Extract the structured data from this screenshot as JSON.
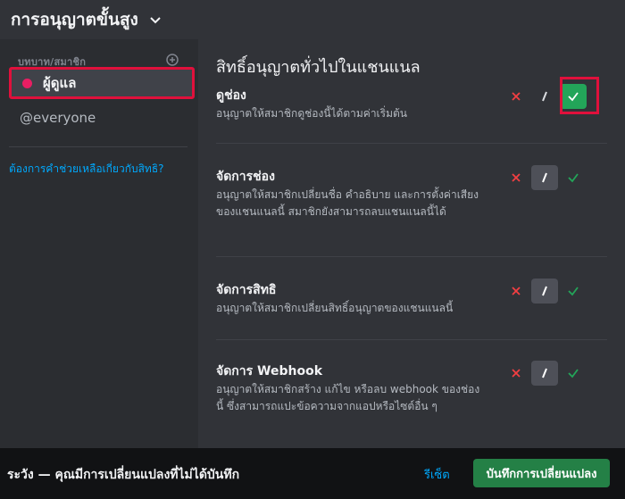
{
  "header": {
    "title": "การอนุญาตขั้นสูง"
  },
  "sidebar": {
    "roles_header": "บทบาท/สมาชิก",
    "roles": [
      {
        "label": "ผู้ดูแล",
        "color": "#e91e63"
      },
      {
        "label": "@everyone"
      }
    ],
    "help_link": "ต้องการคำช่วยเหลือเกี่ยวกับสิทธิ?"
  },
  "main": {
    "section_title": "สิทธิ์อนุญาตทั่วไปในแชนแนล",
    "permissions": [
      {
        "name": "ดูช่อง",
        "desc": "อนุญาตให้สมาชิกดูช่องนี้ได้ตามค่าเริ่มต้น",
        "state": "allow"
      },
      {
        "name": "จัดการช่อง",
        "desc": "อนุญาตให้สมาชิกเปลี่ยนชื่อ คำอธิบาย และการตั้งค่าเสียงของแชนแนลนี้ สมาชิกยังสามารถลบแชนแนลนี้ได้",
        "state": "neutral"
      },
      {
        "name": "จัดการสิทธิ",
        "desc": "อนุญาตให้สมาชิกเปลี่ยนสิทธิ์อนุญาตของแชนแนลนี้",
        "state": "neutral"
      },
      {
        "name": "จัดการ Webhook",
        "desc": "อนุญาตให้สมาชิกสร้าง แก้ไข หรือลบ webhook ของช่องนี้ ซึ่งสามารถแปะข้อความจากแอปหรือไซต์อื่น ๆ",
        "state": "neutral"
      }
    ]
  },
  "footer": {
    "message": "ระวัง — คุณมีการเปลี่ยนแปลงที่ไม่ได้บันทึก",
    "reset_label": "รีเซ็ต",
    "save_label": "บันทึกการเปลี่ยนแปลง"
  },
  "colors": {
    "accent_green": "#23a559",
    "highlight": "#e0103c",
    "deny_red": "#f23f42"
  }
}
